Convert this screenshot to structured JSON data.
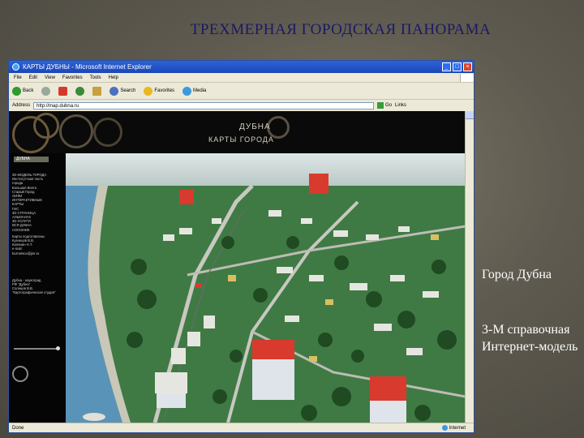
{
  "slide": {
    "title": "ТРЕХМЕРНАЯ ГОРОДСКАЯ ПАНОРАМА",
    "caption_1": "Город Дубна",
    "caption_2": "3-М справочная Интернет-модель"
  },
  "browser": {
    "window_title": "КАРТЫ ДУБНЫ - Microsoft Internet Explorer",
    "menu": [
      "File",
      "Edit",
      "View",
      "Favorites",
      "Tools",
      "Help"
    ],
    "toolbar": [
      {
        "label": "Back",
        "icon": "back-icon",
        "color": "#2f9a2f"
      },
      {
        "label": "",
        "icon": "forward-icon",
        "color": "#9aa89a"
      },
      {
        "label": "",
        "icon": "stop-icon",
        "color": "#d43a2a"
      },
      {
        "label": "",
        "icon": "refresh-icon",
        "color": "#3a8a3a"
      },
      {
        "label": "",
        "icon": "home-icon",
        "color": "#c8a040"
      },
      {
        "label": "Search",
        "icon": "search-icon",
        "color": "#4a70c0"
      },
      {
        "label": "Favorites",
        "icon": "favorites-icon",
        "color": "#e8b820"
      },
      {
        "label": "Media",
        "icon": "media-icon",
        "color": "#3a9ae0"
      }
    ],
    "address_label": "Address",
    "address_value": "http://map.dubna.ru",
    "go_label": "Go",
    "links_label": "Links",
    "status_left": "Done",
    "status_right": "Internet"
  },
  "page": {
    "banner_title": "ДУБНА",
    "banner_subtitle": "КАРТЫ ГОРОДА",
    "side_tab": "ДУБНА",
    "side_links": [
      "3D МОДЕЛЬ ГОРОДА",
      "Институтская часть",
      "города",
      "Большая Волга",
      "Старый Город",
      "ОИЯИ",
      "ИНТЕРАКТИВНЫЕ",
      "КАРТЫ",
      "ГИС",
      "3D СТРАНИЦА",
      "АЛЬМАНАХ",
      "3D УСЛУГИ",
      "ВСЯ ДУБНА",
      "СОЮЗНИК"
    ],
    "side_contacts": [
      "Карты подготовлены",
      "Кузнецов В.В.",
      "Калинин Н.Т.",
      "e-mail:",
      "kuznetsov@jinr.ru"
    ],
    "side_credits": [
      "Дубна - наукоград",
      "РФ \"Дубна\"",
      "Солнцев В.В.",
      "\"Картографическая студия\""
    ]
  },
  "colors": {
    "slide_bg": "#5e5a4f",
    "title": "#1a1a66",
    "ie_titlebar": "#1f55c8",
    "map_grass": "#3f7a44",
    "map_water": "#5a93b8",
    "building_red": "#d83a2e"
  }
}
